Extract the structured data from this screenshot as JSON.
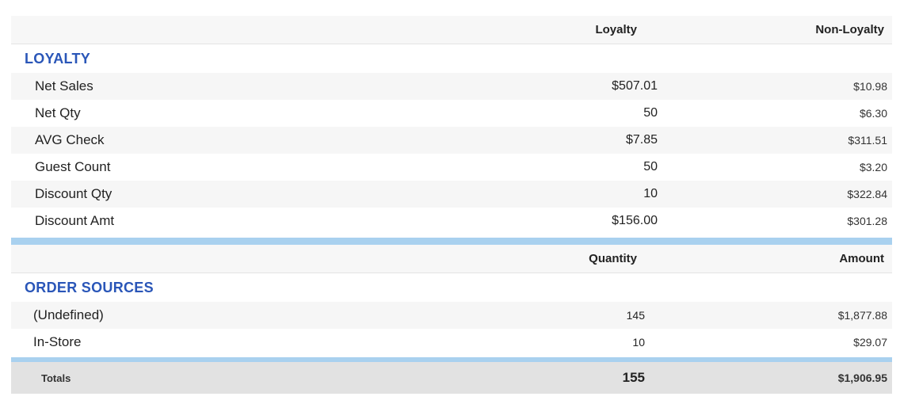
{
  "loyalty_table": {
    "columns": [
      "Loyalty",
      "Non-Loyalty"
    ],
    "section_title": "LOYALTY",
    "rows": [
      {
        "label": "Net Sales",
        "loyalty": "$507.01",
        "non_loyalty": "$10.98"
      },
      {
        "label": "Net Qty",
        "loyalty": "50",
        "non_loyalty": "$6.30"
      },
      {
        "label": "AVG Check",
        "loyalty": "$7.85",
        "non_loyalty": "$311.51"
      },
      {
        "label": "Guest Count",
        "loyalty": "50",
        "non_loyalty": "$3.20"
      },
      {
        "label": "Discount Qty",
        "loyalty": "10",
        "non_loyalty": "$322.84"
      },
      {
        "label": "Discount Amt",
        "loyalty": "$156.00",
        "non_loyalty": "$301.28"
      }
    ]
  },
  "order_sources_table": {
    "columns": [
      "Quantity",
      "Amount"
    ],
    "section_title": "ORDER SOURCES",
    "rows": [
      {
        "label": "(Undefined)",
        "quantity": "145",
        "amount": "$1,877.88"
      },
      {
        "label": "In-Store",
        "quantity": "10",
        "amount": "$29.07"
      }
    ]
  },
  "totals": {
    "label": "Totals",
    "quantity": "155",
    "amount": "$1,906.95"
  },
  "colors": {
    "section_title": "#2a56b8",
    "divider": "#a9d1ef",
    "totals_bg": "#e2e2e2"
  }
}
